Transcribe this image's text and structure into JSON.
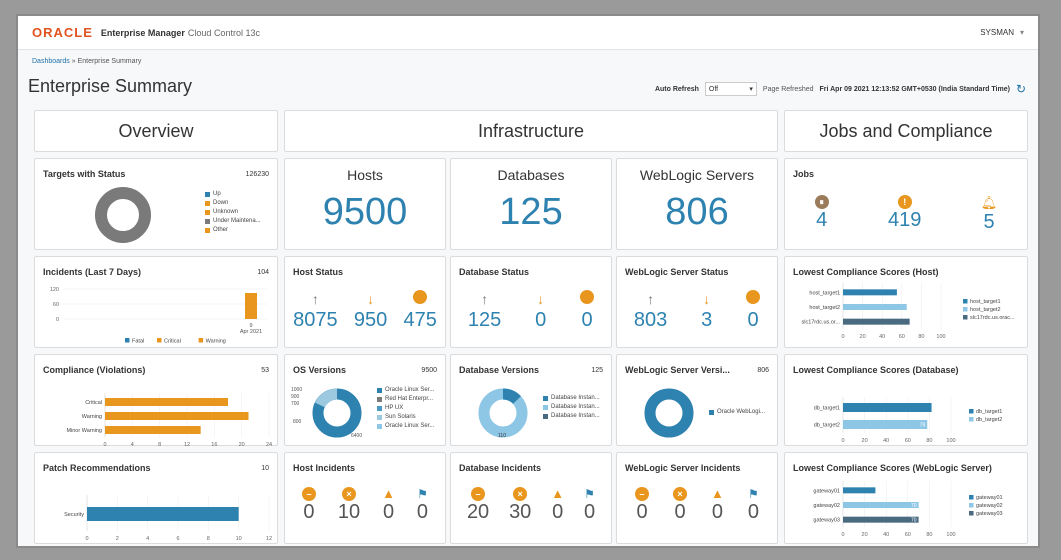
{
  "header": {
    "brand": "ORACLE",
    "product": "Enterprise Manager",
    "product_sub": "Cloud Control 13c",
    "user": "SYSMAN"
  },
  "breadcrumb": {
    "link": "Dashboards",
    "sep": "»",
    "current": "Enterprise Summary"
  },
  "page_title": "Enterprise Summary",
  "refresh": {
    "label": "Auto Refresh",
    "value": "Off",
    "page_refreshed_label": "Page Refreshed",
    "page_refreshed_value": "Fri Apr 09 2021 12:13:52 GMT+0530 (India Standard Time)"
  },
  "sections": {
    "overview": "Overview",
    "infrastructure": "Infrastructure",
    "jobs": "Jobs and Compliance"
  },
  "targets": {
    "title": "Targets with Status",
    "count": "126230",
    "legend": [
      "Up",
      "Down",
      "Unknown",
      "Under Maintena...",
      "Other"
    ],
    "colors": [
      "#2e82b0",
      "#e8961e",
      "#e8961e",
      "#7a7a7a",
      "#e8961e"
    ]
  },
  "hosts": {
    "title": "Hosts",
    "value": "9500"
  },
  "databases": {
    "title": "Databases",
    "value": "125"
  },
  "weblogic": {
    "title": "WebLogic Servers",
    "value": "806"
  },
  "jobs_card": {
    "title": "Jobs",
    "values": [
      "4",
      "419",
      "5"
    ]
  },
  "incidents": {
    "title": "Incidents (Last 7 Days)",
    "count": "104",
    "yticks": [
      "120",
      "60",
      "0"
    ],
    "xlabel1": "9",
    "xlabel2": "Apr 2021",
    "legend": [
      "Fatal",
      "Critical",
      "Warning"
    ],
    "colors": [
      "#2e82b0",
      "#e8961e",
      "#e8961e"
    ]
  },
  "host_status": {
    "title": "Host Status",
    "values": [
      "8075",
      "950",
      "475"
    ]
  },
  "db_status": {
    "title": "Database Status",
    "values": [
      "125",
      "0",
      "0"
    ]
  },
  "wls_status": {
    "title": "WebLogic Server Status",
    "values": [
      "803",
      "3",
      "0"
    ]
  },
  "compliance": {
    "title": "Compliance (Violations)",
    "count": "53",
    "categories": [
      "Critical",
      "Warning",
      "Minor Warning"
    ],
    "values": [
      18,
      21,
      14
    ],
    "xticks": [
      "0",
      "4",
      "8",
      "12",
      "16",
      "20",
      "24"
    ],
    "color": "#e8961e"
  },
  "os_versions": {
    "title": "OS Versions",
    "count": "9500",
    "yticks": [
      "1000",
      "900",
      "700",
      "800"
    ],
    "label": "6400",
    "legend": [
      "Oracle Linux Ser...",
      "Red Hat Enterpr...",
      "HP UX",
      "Sun Solaris",
      "Oracle Linux Ser..."
    ],
    "colors": [
      "#2e82b0",
      "#7a7a7a",
      "#4a9ac5",
      "#9cc9e0",
      "#8ec6e6"
    ]
  },
  "db_versions": {
    "title": "Database Versions",
    "count": "125",
    "label": "110",
    "legend": [
      "Database Instan...",
      "Database Instan...",
      "Database Instan..."
    ],
    "colors": [
      "#2e82b0",
      "#8ec6e6",
      "#4a6a80"
    ]
  },
  "wls_versions": {
    "title": "WebLogic Server Versi...",
    "count": "806",
    "legend": [
      "Oracle WebLogi..."
    ],
    "color": "#2e82b0"
  },
  "lcs_host": {
    "title": "Lowest Compliance Scores (Host)",
    "categories": [
      "host_target1",
      "host_target2",
      "slc17rdc.us.or..."
    ],
    "values": [
      55,
      65,
      68
    ],
    "xticks": [
      "0",
      "20",
      "40",
      "60",
      "80",
      "100"
    ],
    "legend": [
      "host_target1",
      "host_target2",
      "slc17rdc.us.orac..."
    ],
    "colors": [
      "#2e82b0",
      "#8ec6e6",
      "#4a6a80"
    ]
  },
  "lcs_db": {
    "title": "Lowest Compliance Scores (Database)",
    "categories": [
      "db_target1",
      "db_target2"
    ],
    "values": [
      82,
      78
    ],
    "data_labels": [
      "",
      "78"
    ],
    "xticks": [
      "0",
      "20",
      "40",
      "60",
      "80",
      "100"
    ],
    "legend": [
      "db_target1",
      "db_target2"
    ],
    "colors": [
      "#2e82b0",
      "#8ec6e6"
    ]
  },
  "patch": {
    "title": "Patch Recommendations",
    "count": "10",
    "categories": [
      "Security"
    ],
    "values": [
      10
    ],
    "xticks": [
      "0",
      "2",
      "4",
      "6",
      "8",
      "10",
      "12"
    ],
    "color": "#2e82b0"
  },
  "host_incidents": {
    "title": "Host Incidents",
    "values": [
      "0",
      "10",
      "0",
      "0"
    ]
  },
  "db_incidents": {
    "title": "Database Incidents",
    "values": [
      "20",
      "30",
      "0",
      "0"
    ]
  },
  "wls_incidents": {
    "title": "WebLogic Server Incidents",
    "values": [
      "0",
      "0",
      "0",
      "0"
    ]
  },
  "lcs_wls": {
    "title": "Lowest Compliance Scores (WebLogic Server)",
    "categories": [
      "gateway01",
      "gateway02",
      "gateway03"
    ],
    "values": [
      30,
      70,
      70
    ],
    "data_labels": [
      "",
      "70",
      "70"
    ],
    "xticks": [
      "0",
      "20",
      "40",
      "60",
      "80",
      "100"
    ],
    "legend": [
      "gateway01",
      "gateway02",
      "gateway03"
    ],
    "colors": [
      "#2e82b0",
      "#8ec6e6",
      "#4a6a80"
    ]
  },
  "chart_data": [
    {
      "type": "bar",
      "title": "Compliance (Violations)",
      "orientation": "horizontal",
      "categories": [
        "Critical",
        "Warning",
        "Minor Warning"
      ],
      "values": [
        18,
        21,
        14
      ],
      "xlim": [
        0,
        24
      ]
    },
    {
      "type": "bar",
      "title": "Patch Recommendations",
      "orientation": "horizontal",
      "categories": [
        "Security"
      ],
      "values": [
        10
      ],
      "xlim": [
        0,
        12
      ]
    },
    {
      "type": "bar",
      "title": "Lowest Compliance Scores (Host)",
      "orientation": "horizontal",
      "categories": [
        "host_target1",
        "host_target2",
        "slc17rdc.us.or..."
      ],
      "values": [
        55,
        65,
        68
      ],
      "xlim": [
        0,
        100
      ]
    },
    {
      "type": "bar",
      "title": "Lowest Compliance Scores (Database)",
      "orientation": "horizontal",
      "categories": [
        "db_target1",
        "db_target2"
      ],
      "values": [
        82,
        78
      ],
      "xlim": [
        0,
        100
      ]
    },
    {
      "type": "bar",
      "title": "Lowest Compliance Scores (WebLogic Server)",
      "orientation": "horizontal",
      "categories": [
        "gateway01",
        "gateway02",
        "gateway03"
      ],
      "values": [
        30,
        70,
        70
      ],
      "xlim": [
        0,
        100
      ]
    },
    {
      "type": "bar",
      "title": "Incidents (Last 7 Days)",
      "categories": [
        "9 Apr 2021"
      ],
      "series": [
        {
          "name": "Critical",
          "values": [
            104
          ]
        }
      ],
      "ylim": [
        0,
        120
      ]
    }
  ]
}
